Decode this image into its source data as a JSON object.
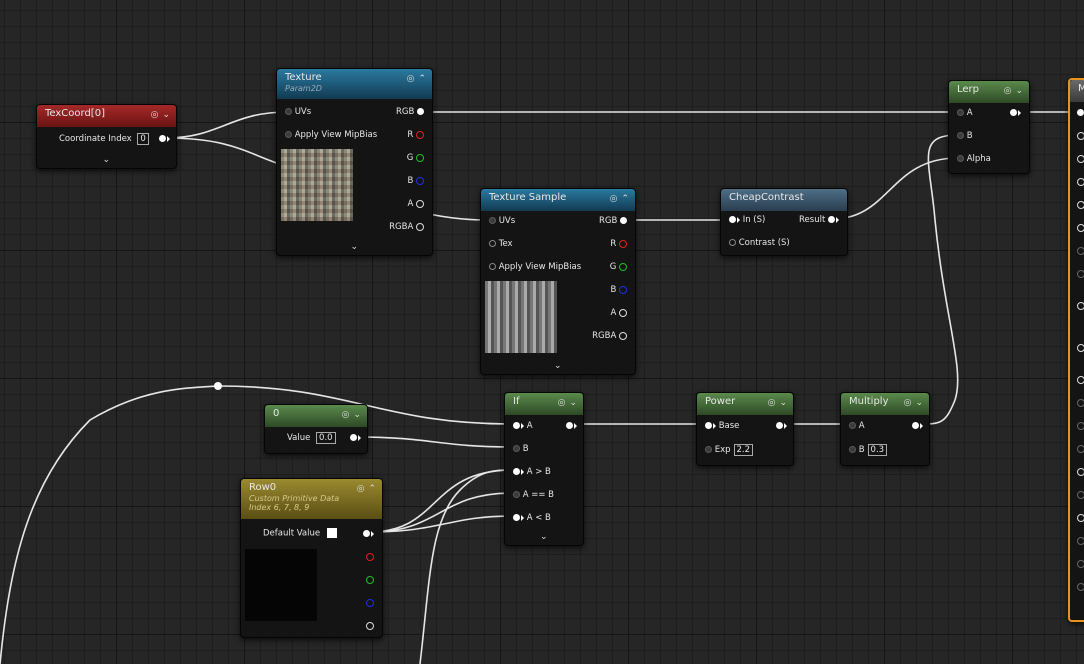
{
  "nodes": {
    "texcoord": {
      "title": "TexCoord[0]",
      "param_label": "Coordinate Index",
      "param_value": "0"
    },
    "texture_param": {
      "title": "Texture",
      "subtitle": "Param2D",
      "in_uvs": "UVs",
      "in_mip": "Apply View MipBias",
      "out_rgb": "RGB",
      "out_r": "R",
      "out_g": "G",
      "out_b": "B",
      "out_a": "A",
      "out_rgba": "RGBA"
    },
    "texture_sample": {
      "title": "Texture Sample",
      "in_uvs": "UVs",
      "in_tex": "Tex",
      "in_mip": "Apply View MipBias",
      "out_rgb": "RGB",
      "out_r": "R",
      "out_g": "G",
      "out_b": "B",
      "out_a": "A",
      "out_rgba": "RGBA"
    },
    "cheap_contrast": {
      "title": "CheapContrast",
      "in_s": "In (S)",
      "in_contrast": "Contrast (S)",
      "out_result": "Result"
    },
    "lerp": {
      "title": "Lerp",
      "in_a": "A",
      "in_b": "B",
      "in_alpha": "Alpha"
    },
    "constant": {
      "title": "0",
      "param_label": "Value",
      "param_value": "0.0"
    },
    "if_node": {
      "title": "If",
      "in_a": "A",
      "in_b": "B",
      "in_gt": "A > B",
      "in_eq": "A == B",
      "in_lt": "A < B"
    },
    "power": {
      "title": "Power",
      "in_base": "Base",
      "param_label": "Exp",
      "param_value": "2.2"
    },
    "multiply": {
      "title": "Multiply",
      "in_a": "A",
      "param_label": "B",
      "param_value": "0.3"
    },
    "row0": {
      "title": "Row0",
      "subtitle1": "Custom Primitive Data",
      "subtitle2": "Index 6, 7, 8, 9",
      "param_label": "Default Value"
    },
    "material": {
      "title": "M"
    }
  },
  "colors": {
    "texcoord_header": "#8a1f1f",
    "texture_header": "#1e5a78",
    "math_header": "#44673a",
    "contrast_header": "#3e5a70",
    "param_header": "#7a6c22",
    "material_border": "#e8931c",
    "pin_r": "#e02020",
    "pin_g": "#20c020",
    "pin_b": "#2030e0"
  }
}
